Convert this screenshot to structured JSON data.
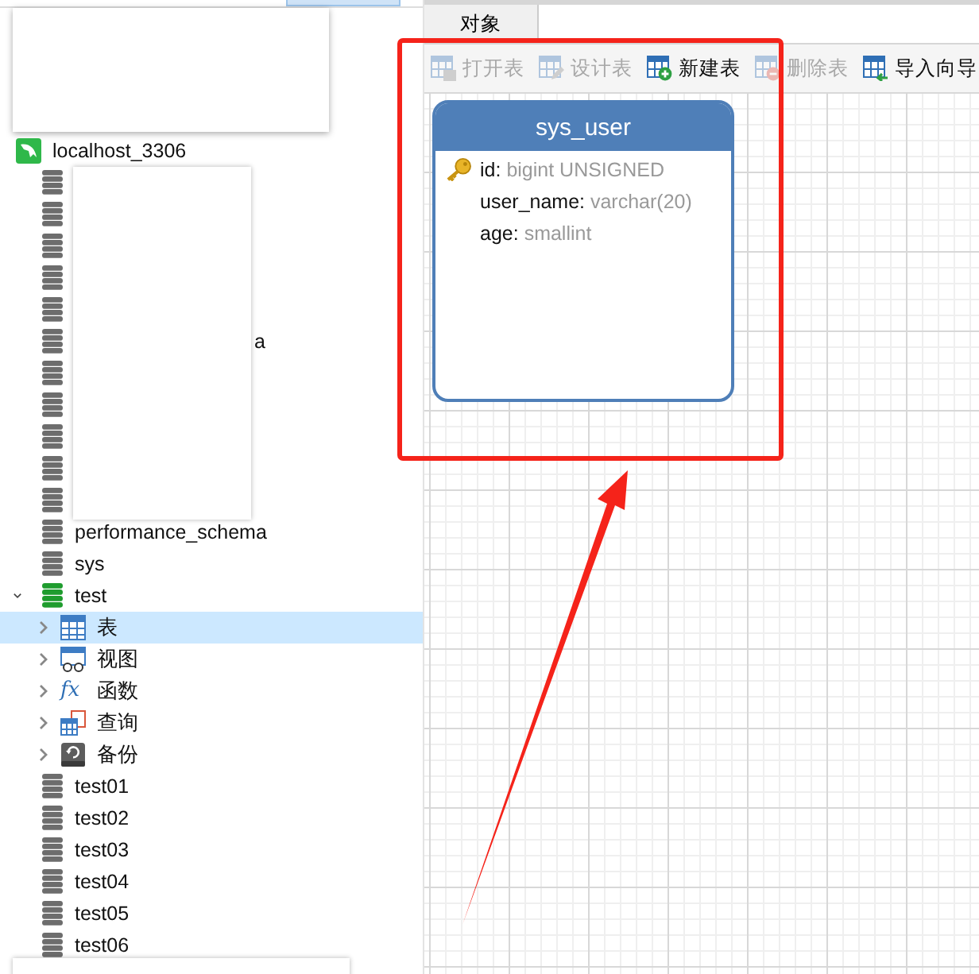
{
  "connection": {
    "name": "localhost_3306"
  },
  "databases": [
    {
      "kind": "redacted"
    },
    {
      "kind": "redacted"
    },
    {
      "kind": "redacted"
    },
    {
      "kind": "redacted"
    },
    {
      "kind": "redacted"
    },
    {
      "kind": "redacted",
      "tail": "a"
    },
    {
      "kind": "redacted"
    },
    {
      "kind": "redacted"
    },
    {
      "kind": "redacted"
    },
    {
      "kind": "redacted"
    },
    {
      "kind": "redacted"
    },
    {
      "name": "performance_schema"
    },
    {
      "name": "sys"
    },
    {
      "name": "test",
      "expanded": true,
      "children": [
        {
          "label": "表",
          "kind": "table",
          "expanded": false,
          "selected": true
        },
        {
          "label": "视图",
          "kind": "view",
          "expanded": false,
          "selected": false
        },
        {
          "label": "函数",
          "kind": "function",
          "icon": "fx",
          "expanded": false,
          "selected": false
        },
        {
          "label": "查询",
          "kind": "query",
          "expanded": false,
          "selected": false
        },
        {
          "label": "备份",
          "kind": "backup",
          "expanded": false,
          "selected": false
        }
      ]
    },
    {
      "name": "test01"
    },
    {
      "name": "test02"
    },
    {
      "name": "test03"
    },
    {
      "name": "test04"
    },
    {
      "name": "test05"
    },
    {
      "name": "test06"
    }
  ],
  "tabs": [
    {
      "label": "对象",
      "selected": true
    }
  ],
  "toolbar": [
    {
      "label": "打开表",
      "kind": "open",
      "disabled": true
    },
    {
      "label": "设计表",
      "kind": "design",
      "disabled": true
    },
    {
      "label": "新建表",
      "kind": "new",
      "disabled": false
    },
    {
      "label": "删除表",
      "kind": "delete",
      "disabled": true
    },
    {
      "label": "导入向导",
      "kind": "import",
      "disabled": false
    }
  ],
  "table_card": {
    "name": "sys_user",
    "fields": [
      {
        "name": "id:",
        "type": "bigint UNSIGNED",
        "primary_key": true
      },
      {
        "name": "user_name:",
        "type": "varchar(20)",
        "primary_key": false
      },
      {
        "name": "age:",
        "type": "smallint",
        "primary_key": false
      }
    ]
  }
}
